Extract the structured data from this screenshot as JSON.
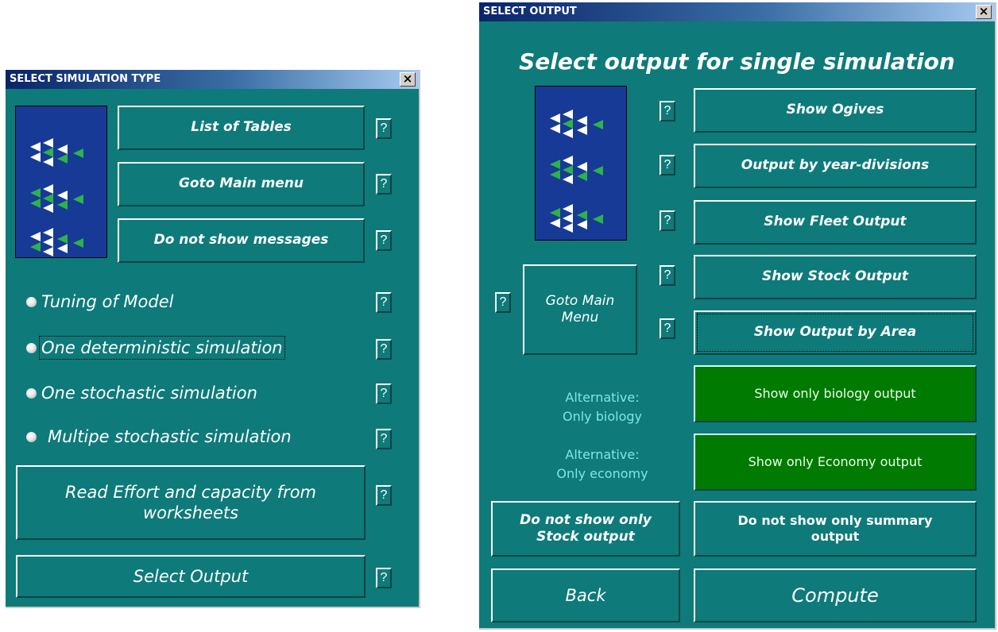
{
  "sim_window": {
    "title": "SELECT SIMULATION TYPE",
    "close": "×",
    "buttons": {
      "list_tables": "List of Tables",
      "main_menu": "Goto Main menu",
      "no_messages": "Do not show messages",
      "read_effort": "Read Effort and capacity from worksheets",
      "select_output": "Select Output"
    },
    "options": [
      {
        "label": "Tuning of Model"
      },
      {
        "label": "One deterministic simulation"
      },
      {
        "label": "One stochastic simulation"
      },
      {
        "label": "Multipe stochastic simulation"
      }
    ],
    "help": "?"
  },
  "out_window": {
    "title": "SELECT OUTPUT",
    "close": "×",
    "heading": "Select output for single simulation",
    "buttons": {
      "ogives": "Show Ogives",
      "year_divisions": "Output by year-divisions",
      "fleet": "Show Fleet Output",
      "stock": "Show Stock Output",
      "area": "Show Output by Area",
      "goto_main": "Goto Main Menu",
      "biology_only": "Show only biology output",
      "economy_only": "Show only Economy output",
      "no_stock_only": "Do not show only Stock output",
      "no_summary_only": "Do not show only summary output",
      "back": "Back",
      "compute": "Compute"
    },
    "alt_biology": [
      "Alternative:",
      "Only biology"
    ],
    "alt_economy": [
      "Alternative:",
      "Only economy"
    ],
    "help": "?"
  },
  "colors": {
    "dialog_bg": "#0e7a7a",
    "green_button": "#007a00",
    "logo_bg": "#163a96",
    "alt_label": "#7fe6e0"
  }
}
